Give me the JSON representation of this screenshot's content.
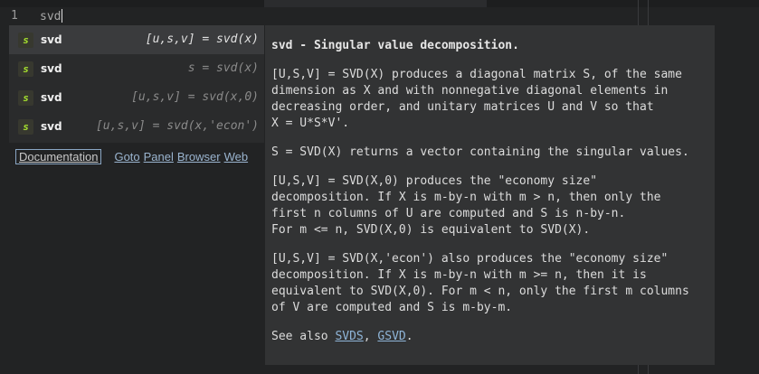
{
  "editor": {
    "line_number": "1",
    "text": "svd"
  },
  "completion": {
    "items": [
      {
        "badge": "s",
        "name": "svd",
        "signature": "[u,s,v] = svd(x)",
        "selected": true
      },
      {
        "badge": "s",
        "name": "svd",
        "signature": "s = svd(x)",
        "selected": false
      },
      {
        "badge": "s",
        "name": "svd",
        "signature": "[u,s,v] = svd(x,0)",
        "selected": false
      },
      {
        "badge": "s",
        "name": "svd",
        "signature": "[u,s,v] = svd(x,'econ')",
        "selected": false
      }
    ]
  },
  "links": {
    "documentation": "Documentation",
    "goto": "Goto",
    "panel": "Panel",
    "browser": "Browser",
    "web": "Web"
  },
  "doc": {
    "title": "svd - Singular value decomposition.",
    "p1": "[U,S,V] = SVD(X) produces a diagonal matrix S, of the same\ndimension as X and with nonnegative diagonal elements in\ndecreasing order, and unitary matrices U and V so that\nX = U*S*V'.",
    "p2": "S = SVD(X) returns a vector containing the singular values.",
    "p3": "[U,S,V] = SVD(X,0) produces the \"economy size\"\ndecomposition. If X is m-by-n with m > n, then only the\nfirst n columns of U are computed and S is n-by-n.\nFor m <= n, SVD(X,0) is equivalent to SVD(X).",
    "p4": "[U,S,V] = SVD(X,'econ') also produces the \"economy size\"\ndecomposition. If X is m-by-n with m >= n, then it is\nequivalent to SVD(X,0). For m < n, only the first m columns\nof V are computed and S is m-by-m.",
    "see_also_prefix": "See also ",
    "see_also_1": "SVDS",
    "see_also_sep": ", ",
    "see_also_2": "GSVD",
    "see_also_suffix": "."
  },
  "colors": {
    "background": "#222324",
    "popup": "#2a2b2c",
    "selected": "#3a3b3d",
    "badge_text": "#a6e22e",
    "link": "#9ab4cf"
  }
}
